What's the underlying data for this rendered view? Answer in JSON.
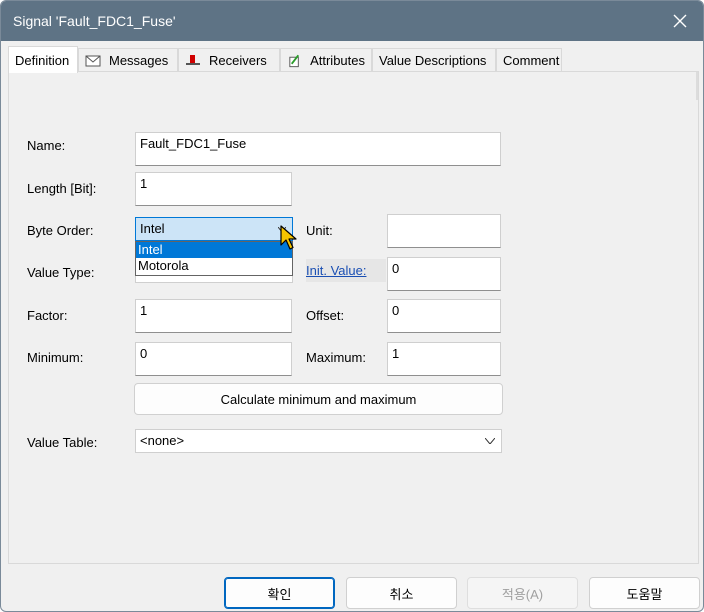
{
  "window": {
    "title": "Signal 'Fault_FDC1_Fuse'"
  },
  "tabs": [
    {
      "label": "Definition",
      "icon": "none"
    },
    {
      "label": "Messages",
      "icon": "envelope-icon"
    },
    {
      "label": "Receivers",
      "icon": "receiver-icon"
    },
    {
      "label": "Attributes",
      "icon": "attributes-pencil-icon"
    },
    {
      "label": "Value Descriptions",
      "icon": "none"
    },
    {
      "label": "Comment",
      "icon": "none"
    }
  ],
  "form": {
    "name_label": "Name:",
    "name_value": "Fault_FDC1_Fuse",
    "length_label": "Length [Bit]:",
    "length_value": "1",
    "byte_order_label": "Byte Order:",
    "byte_order_value": "Intel",
    "byte_order_options": [
      "Intel",
      "Motorola"
    ],
    "unit_label": "Unit:",
    "unit_value": "",
    "value_type_label": "Value Type:",
    "init_value_label": "Init. Value:",
    "init_value": "0",
    "factor_label": "Factor:",
    "factor_value": "1",
    "offset_label": "Offset:",
    "offset_value": "0",
    "minimum_label": "Minimum:",
    "minimum_value": "0",
    "maximum_label": "Maximum:",
    "maximum_value": "1",
    "calc_button": "Calculate minimum and maximum",
    "value_table_label": "Value Table:",
    "value_table_value": "<none>"
  },
  "footer": {
    "ok": "확인",
    "cancel": "취소",
    "apply": "적용(A)",
    "help": "도움말"
  },
  "colors": {
    "titlebar": "#5e7385",
    "accent": "#0078d7",
    "link": "#1a4fb3"
  }
}
